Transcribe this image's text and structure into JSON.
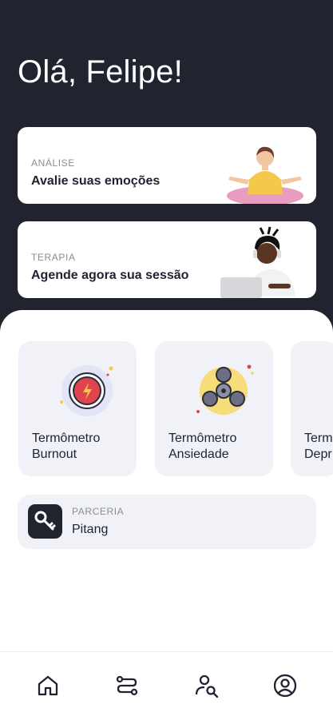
{
  "greeting": "Olá, Felipe!",
  "cards": [
    {
      "kicker": "ANÁLISE",
      "title": "Avalie suas emoções",
      "icon": "meditating-woman-illustration"
    },
    {
      "kicker": "TERAPIA",
      "title": "Agende agora sua sessão",
      "icon": "person-with-laptop-illustration"
    }
  ],
  "tiles": [
    {
      "label": "Termômetro\nBurnout",
      "icon": "burnout-gauge-icon"
    },
    {
      "label": "Termômetro\nAnsiedade",
      "icon": "fidget-spinner-icon"
    },
    {
      "label": "Term\nDepr",
      "icon": ""
    }
  ],
  "partner": {
    "kicker": "PARCERIA",
    "name": "Pitang",
    "icon": "key-icon"
  },
  "nav": [
    "home-icon",
    "routes-icon",
    "search-user-icon",
    "profile-icon"
  ],
  "colors": {
    "dark": "#21242f",
    "tile": "#f1f2f7",
    "muted": "#8a8d98"
  }
}
